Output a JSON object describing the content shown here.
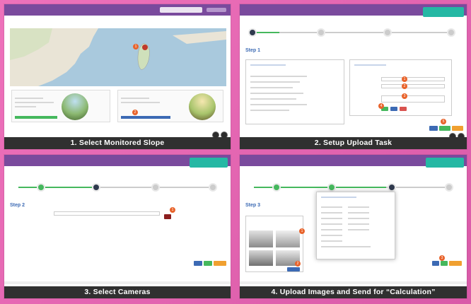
{
  "captions": {
    "step1": "1. Select Monitored Slope",
    "step2": "2. Setup Upload Task",
    "step3": "3. Select Cameras",
    "step4": "4. Upload Images and Send for “Calculation”"
  },
  "markers": {
    "p1_a": "1",
    "p1_b": "2",
    "p2_a": "1",
    "p2_b": "2",
    "p2_c": "3",
    "p2_d": "4",
    "p2_e": "5",
    "p3_a": "1",
    "p4_a": "1",
    "p4_b": "2",
    "p4_c": "3"
  },
  "step_headings": {
    "step1": "Step 1",
    "step2": "Step 2",
    "step3": "Step 3"
  },
  "colors": {
    "background": "#e46bb0",
    "topbar": "#7a4a9d",
    "caption_bg": "#303030",
    "step_done": "#45b85d",
    "step_current": "#2f3a4e",
    "badge": "#e8632b",
    "notice": "#25b8a4"
  }
}
